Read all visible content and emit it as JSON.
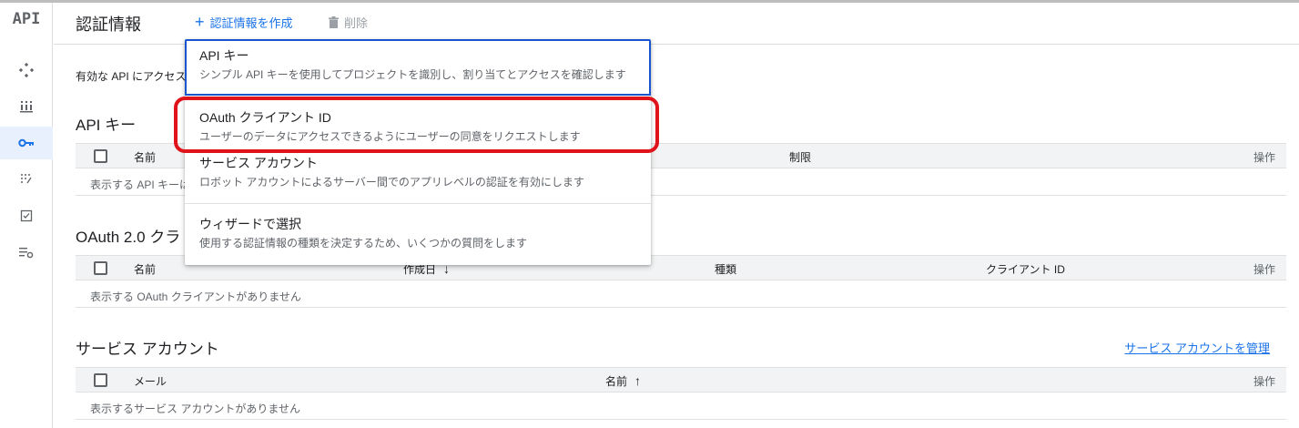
{
  "app": {
    "logo": "API"
  },
  "header": {
    "title": "認証情報",
    "create_label": "認証情報を作成",
    "delete_label": "削除"
  },
  "intro_text": "有効な API にアクセス",
  "api_keys": {
    "title": "API キー",
    "columns": {
      "name": "名前",
      "restriction": "制限",
      "actions": "操作"
    },
    "empty": "表示する API キーはありません"
  },
  "oauth": {
    "title": "OAuth 2.0 クラ",
    "columns": {
      "name": "名前",
      "created": "作成日",
      "type": "種類",
      "client_id": "クライアント ID",
      "actions": "操作"
    },
    "empty": "表示する OAuth クライアントがありません"
  },
  "service_accounts": {
    "title": "サービス アカウント",
    "manage_link": "サービス アカウントを管理",
    "columns": {
      "email": "メール",
      "name": "名前",
      "actions": "操作"
    },
    "empty": "表示するサービス アカウントがありません"
  },
  "menu": {
    "items": [
      {
        "title": "API キー",
        "desc": "シンプル API キーを使用してプロジェクトを識別し、割り当てとアクセスを確認します"
      },
      {
        "title": "OAuth クライアント ID",
        "desc": "ユーザーのデータにアクセスできるようにユーザーの同意をリクエストします"
      },
      {
        "title": "サービス アカウント",
        "desc": "ロボット アカウントによるサーバー間でのアプリレベルの認証を有効にします"
      },
      {
        "title": "ウィザードで選択",
        "desc": "使用する認証情報の種類を決定するため、いくつかの質問をします"
      }
    ]
  },
  "colors": {
    "accent": "#1a73e8",
    "highlight": "#e0121a",
    "selected_border": "#1a55d0"
  }
}
